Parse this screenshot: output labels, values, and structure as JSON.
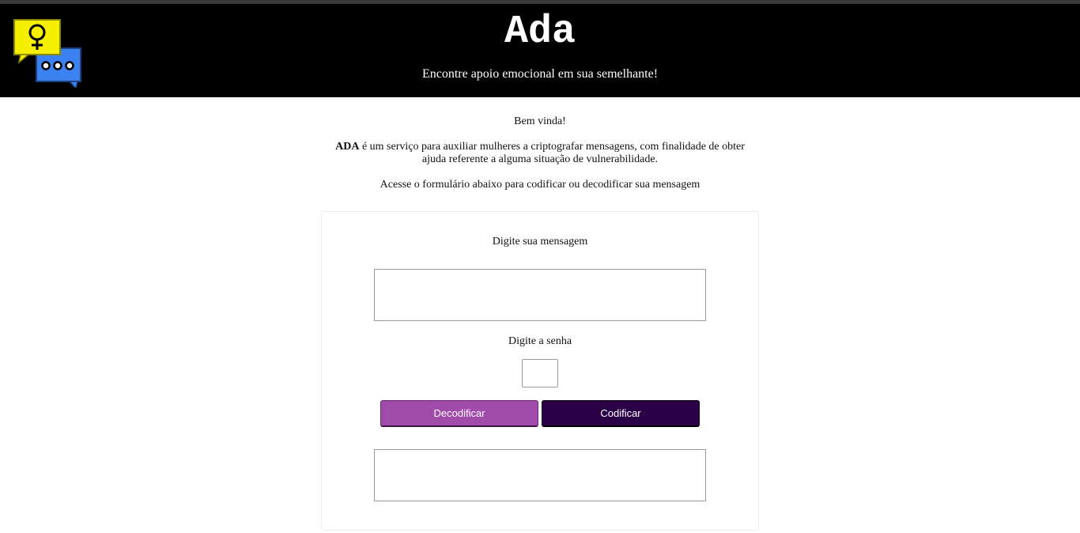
{
  "header": {
    "title": "Ada",
    "tagline": "Encontre apoio emocional em sua semelhante!"
  },
  "intro": {
    "welcome": "Bem vinda!",
    "brand": "ADA",
    "description": " é um serviço para auxiliar mulheres a criptografar mensagens, com finalidade de obter ajuda referente a alguma situação de vulnerabilidade.",
    "instruction": "Acesse o formulário abaixo para codificar ou decodificar sua mensagem"
  },
  "form": {
    "message_label": "Digite sua mensagem",
    "message_value": "",
    "password_label": "Digite a senha",
    "password_value": "",
    "decode_button": "Decodificar",
    "encode_button": "Codificar",
    "output_value": ""
  },
  "colors": {
    "header_bg": "#000000",
    "decode_button": "#a04aaa",
    "encode_button": "#2a0046",
    "logo_yellow": "#f5f000",
    "logo_blue": "#3b82f0"
  },
  "icons": {
    "logo": "chat-bubbles-female-symbol-icon"
  }
}
